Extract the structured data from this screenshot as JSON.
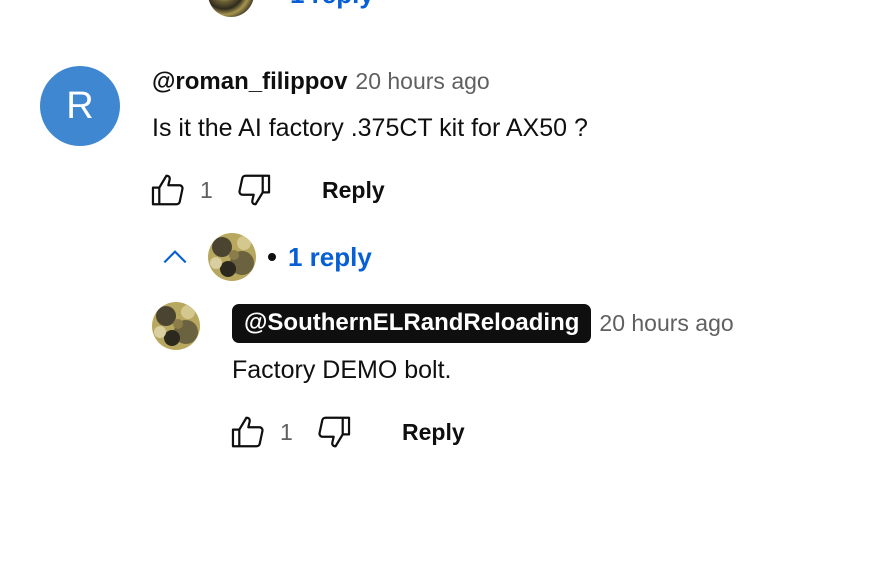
{
  "previous_thread": {
    "replies_label": "1 reply"
  },
  "comment": {
    "avatar_letter": "R",
    "avatar_color": "#3f88d1",
    "author": "@roman_filippov",
    "time": "20 hours ago",
    "text": "Is it the AI factory .375CT kit for AX50 ?",
    "like_count": "1",
    "reply_label": "Reply"
  },
  "replies_toggle": {
    "label": "1 reply",
    "icon": "chevron-up-icon"
  },
  "reply": {
    "author": "@SouthernELRandReloading",
    "time": "20 hours ago",
    "text": "Factory DEMO bolt.",
    "like_count": "1",
    "reply_label": "Reply"
  },
  "colors": {
    "link_blue": "#065fd4",
    "secondary_text": "#606060",
    "chip_bg": "#0f0f0f"
  }
}
